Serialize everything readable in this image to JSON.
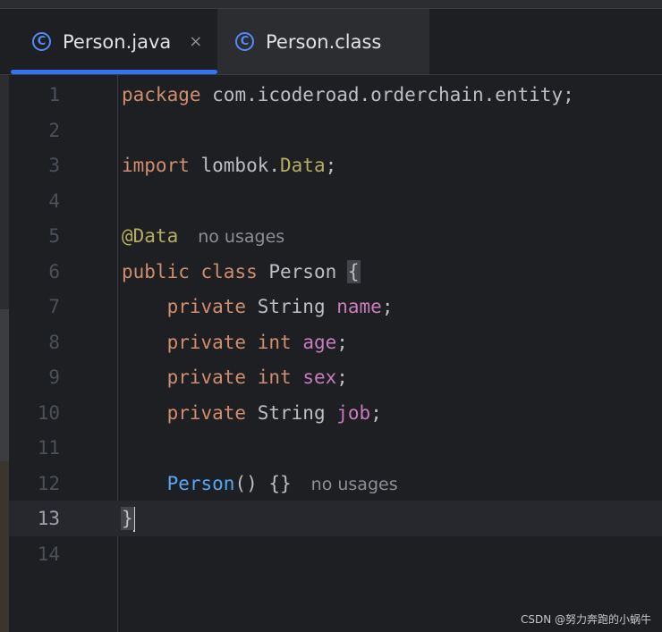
{
  "tabs": [
    {
      "icon": "C",
      "label": "Person.java",
      "close": "×",
      "active": true
    },
    {
      "icon": "C",
      "label": "Person.class",
      "active": false
    }
  ],
  "code": {
    "line_numbers": [
      "1",
      "2",
      "3",
      "4",
      "5",
      "6",
      "7",
      "8",
      "9",
      "10",
      "11",
      "12",
      "13",
      "14"
    ],
    "current_line": 13,
    "l1": {
      "keyword": "package",
      "text": " com.icoderoad.orderchain.entity;"
    },
    "l3": {
      "keyword": "import",
      "text_pre": " lombok.",
      "annotation": "Data",
      "text_post": ";"
    },
    "l5": {
      "annotation": "@Data",
      "hint": "no usages"
    },
    "l6": {
      "kw1": "public",
      "kw2": "class",
      "name": " Person ",
      "brace": "{"
    },
    "l7": {
      "indent": "    ",
      "kw": "private",
      "type": " String ",
      "field": "name",
      "end": ";"
    },
    "l8": {
      "indent": "    ",
      "kw1": "private",
      "kw2": "int",
      "field": "age",
      "end": ";"
    },
    "l9": {
      "indent": "    ",
      "kw1": "private",
      "kw2": "int",
      "field": "sex",
      "end": ";"
    },
    "l10": {
      "indent": "    ",
      "kw": "private",
      "type": " String ",
      "field": "job",
      "end": ";"
    },
    "l12": {
      "indent": "    ",
      "ctor": "Person",
      "rest": "() {}",
      "hint": "no usages"
    },
    "l13": {
      "brace": "}"
    }
  },
  "watermark": "CSDN @努力奔跑的小蜗牛",
  "colors": {
    "background": "#1e1f22",
    "keyword": "#cf8e6d",
    "annotation": "#b3ae60",
    "field": "#c77dbb",
    "function": "#56a8f5",
    "accent": "#3574f0"
  }
}
